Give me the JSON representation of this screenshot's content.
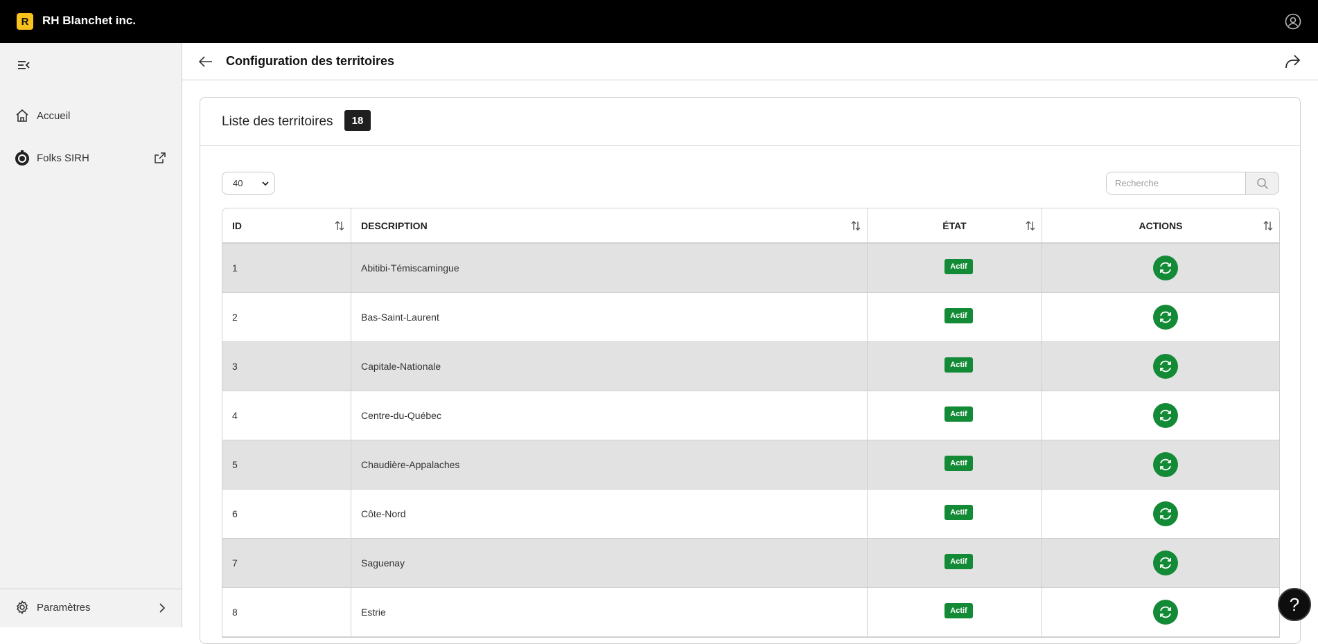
{
  "app": {
    "logo_letter": "R",
    "company": "RH Blanchet inc."
  },
  "sidebar": {
    "items": [
      {
        "label": "Accueil",
        "icon": "home-icon"
      },
      {
        "label": "Folks SIRH",
        "icon": "folks-icon"
      }
    ],
    "bottom": {
      "label": "Paramètres",
      "icon": "gear-icon"
    }
  },
  "header": {
    "title": "Configuration des territoires"
  },
  "card": {
    "title": "Liste des territoires",
    "count": "18"
  },
  "controls": {
    "page_size": "40",
    "search_placeholder": "Recherche"
  },
  "table": {
    "columns": [
      "ID",
      "DESCRIPTION",
      "ÉTAT",
      "ACTIONS"
    ],
    "rows": [
      {
        "id": "1",
        "description": "Abitibi-Témiscamingue",
        "status": "Actif"
      },
      {
        "id": "2",
        "description": "Bas-Saint-Laurent",
        "status": "Actif"
      },
      {
        "id": "3",
        "description": "Capitale-Nationale",
        "status": "Actif"
      },
      {
        "id": "4",
        "description": "Centre-du-Québec",
        "status": "Actif"
      },
      {
        "id": "5",
        "description": "Chaudière-Appalaches",
        "status": "Actif"
      },
      {
        "id": "6",
        "description": "Côte-Nord",
        "status": "Actif"
      },
      {
        "id": "7",
        "description": "Saguenay",
        "status": "Actif"
      },
      {
        "id": "8",
        "description": "Estrie",
        "status": "Actif"
      }
    ]
  },
  "help": {
    "label": "?"
  },
  "colors": {
    "topbar": "#000000",
    "logo": "#f7c21b",
    "status_green": "#138a36",
    "alt_row": "#e2e2e2"
  }
}
